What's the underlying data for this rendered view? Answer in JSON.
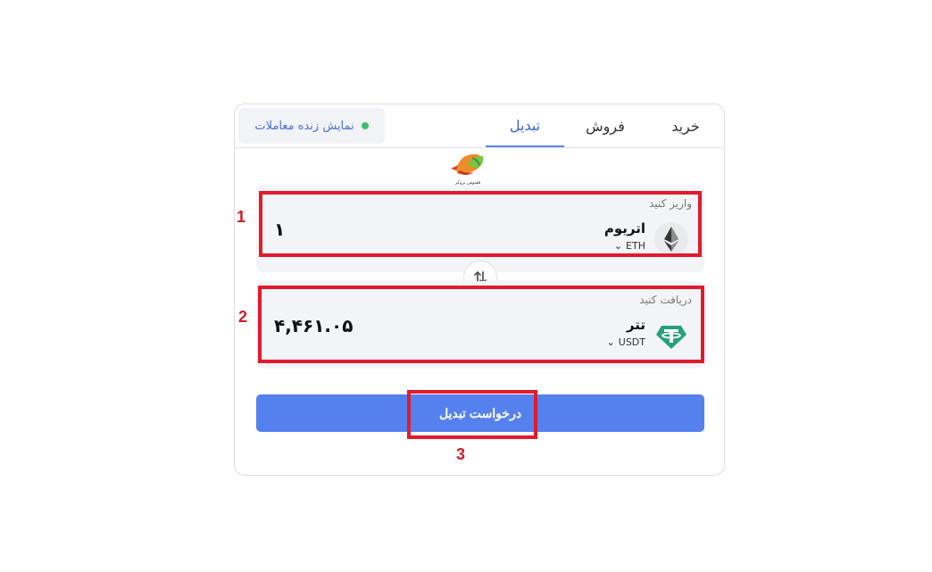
{
  "tabs": {
    "buy": "خرید",
    "sell": "فروش",
    "convert": "تبدیل",
    "active": "convert"
  },
  "live_trades": {
    "label": "نمایش زنده معاملات",
    "status_color": "#3fbf6b"
  },
  "logo": {
    "caption": "ققنوس بروکر"
  },
  "deposit": {
    "label": "واریز کنید",
    "coin_name": "اتریوم",
    "coin_symbol": "ETH",
    "amount": "۱",
    "icon": "ethereum-icon"
  },
  "receive": {
    "label": "دریافت کنید",
    "coin_name": "تتر",
    "coin_symbol": "USDT",
    "amount": "۴,۴۶۱.۰۵",
    "icon": "tether-icon"
  },
  "swap_icon": "swap-arrows-icon",
  "submit_label": "درخواست تبدیل",
  "annotations": [
    "1",
    "2",
    "3"
  ],
  "colors": {
    "accent": "#5581ef",
    "highlight": "#e21b2b",
    "tether": "#26a17b"
  }
}
